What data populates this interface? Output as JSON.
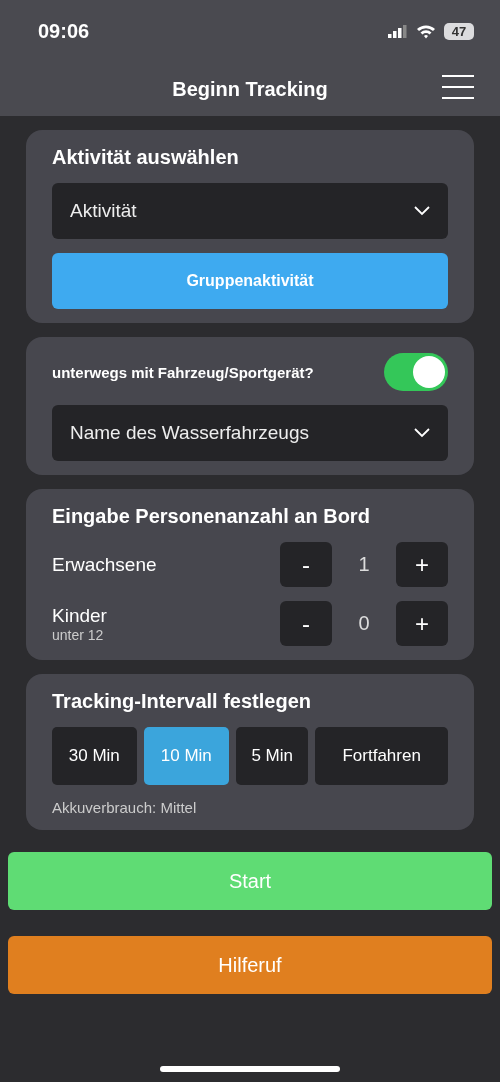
{
  "status_bar": {
    "time": "09:06",
    "battery": "47"
  },
  "header": {
    "title": "Beginn Tracking"
  },
  "activity": {
    "title": "Aktivität auswählen",
    "select": {
      "value": "Aktivität"
    },
    "group_button": "Gruppenaktivität"
  },
  "vehicle": {
    "label": "unterwegs mit Fahrzeug/Sportgerät?",
    "on": true,
    "select": {
      "value": "Name des Wasserfahrzeugs"
    }
  },
  "persons": {
    "title": "Eingabe Personenanzahl an Bord",
    "rows": [
      {
        "label": "Erwachsene",
        "sublabel": null,
        "minus": "-",
        "count": "1",
        "plus": "+"
      },
      {
        "label": "Kinder",
        "sublabel": "unter 12",
        "minus": "-",
        "count": "0",
        "plus": "+"
      }
    ]
  },
  "interval": {
    "title": "Tracking-Intervall festlegen",
    "options": [
      {
        "label": "30 Min",
        "selected": false
      },
      {
        "label": "10 Min",
        "selected": true
      },
      {
        "label": "5 Min",
        "selected": false
      },
      {
        "label": "Fortfahren",
        "selected": false
      }
    ],
    "note": "Akkuverbrauch: Mittel"
  },
  "actions": [
    {
      "kind": "start",
      "label": "Start"
    },
    {
      "kind": "alarm",
      "label": "Hilferuf"
    }
  ]
}
